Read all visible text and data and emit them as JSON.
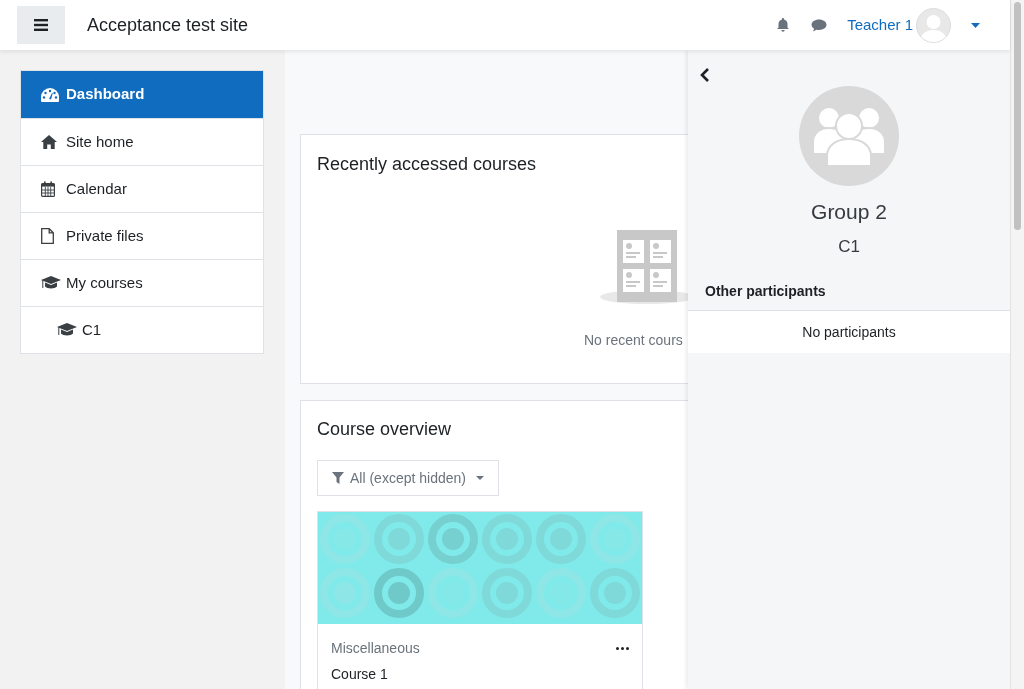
{
  "header": {
    "site_name": "Acceptance test site",
    "user_name": "Teacher 1"
  },
  "nav": [
    {
      "label": "Dashboard",
      "selected": true
    },
    {
      "label": "Site home",
      "selected": false
    },
    {
      "label": "Calendar",
      "selected": false
    },
    {
      "label": "Private files",
      "selected": false
    },
    {
      "label": "My courses",
      "selected": false,
      "children": [
        {
          "label": "C1",
          "selected": false
        }
      ]
    }
  ],
  "recent_block": {
    "title": "Recently accessed courses",
    "empty_text": "No recent cours"
  },
  "overview_block": {
    "title": "Course overview",
    "filter": "All (except hidden)",
    "courses": [
      {
        "category": "Miscellaneous",
        "name": "Course 1"
      }
    ]
  },
  "drawer": {
    "group_name": "Group 2",
    "course": "C1",
    "section_title": "Other participants",
    "empty_text": "No participants"
  }
}
